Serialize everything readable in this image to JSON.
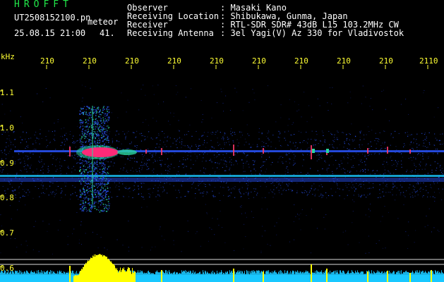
{
  "header": {
    "app_title": "HROFFT",
    "file_name": "UT2508152100.pn",
    "meteor_label": "meteor",
    "datetime": "25.08.15 21:00",
    "count": "41.",
    "observer_label": "Observer",
    "observer_value": ": Masaki Kano",
    "location_label": "Receiving Location",
    "location_value": ": Shibukawa, Gunma, Japan",
    "receiver_label": "Receiver",
    "receiver_value": ": RTL-SDR SDR# 43dB L15 103.2MHz CW",
    "antenna_label": "Receiving Antenna",
    "antenna_value": ": 3el Yagi(V) Az 330 for Vladivostok"
  },
  "axes": {
    "y_unit": "kHz",
    "y_ticks": [
      "1.1",
      "1.0",
      "0.9",
      "0.8",
      "0.7",
      "0.6"
    ],
    "x_ticks": [
      "210",
      "210",
      "210",
      "210",
      "210",
      "210",
      "210",
      "210",
      "210",
      "2110"
    ]
  },
  "colors": {
    "background": "#000000",
    "text_green": "#22e84a",
    "text_white": "#ffffff",
    "tick_yellow": "#ffff33",
    "signal_blue": "#2a55ff",
    "echo_magenta": "#ff2a78",
    "baseline_cyan": "#19c8ff"
  }
}
